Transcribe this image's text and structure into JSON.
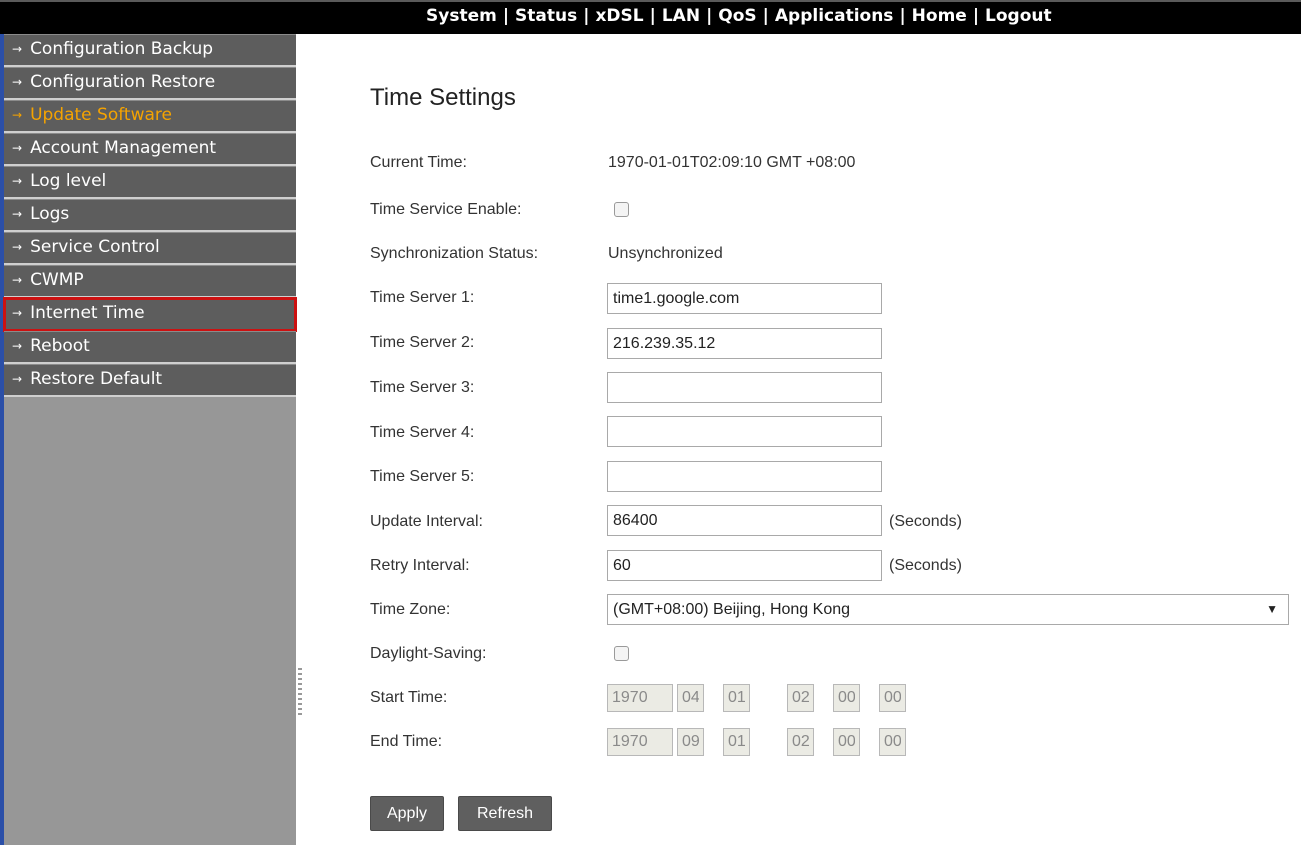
{
  "topnav": {
    "items": [
      "System",
      "Status",
      "xDSL",
      "LAN",
      "QoS",
      "Applications",
      "Home",
      "Logout"
    ],
    "separator": "|"
  },
  "sidebar": {
    "arrow_icon": "→",
    "items": [
      {
        "label": "Configuration Backup"
      },
      {
        "label": "Configuration Restore"
      },
      {
        "label": "Update Software",
        "active": true
      },
      {
        "label": "Account Management"
      },
      {
        "label": "Log level"
      },
      {
        "label": "Logs"
      },
      {
        "label": "Service Control"
      },
      {
        "label": "CWMP"
      },
      {
        "label": "Internet Time",
        "highlighted": true
      },
      {
        "label": "Reboot"
      },
      {
        "label": "Restore Default"
      }
    ]
  },
  "page": {
    "title": "Time Settings",
    "current_time": {
      "label": "Current Time:",
      "value": "1970-01-01T02:09:10 GMT +08:00"
    },
    "time_service": {
      "label": "Time Service Enable:",
      "checked": false
    },
    "sync_status": {
      "label": "Synchronization Status:",
      "value": "Unsynchronized"
    },
    "servers": [
      {
        "label": "Time Server 1:",
        "value": "time1.google.com"
      },
      {
        "label": "Time Server 2:",
        "value": "216.239.35.12"
      },
      {
        "label": "Time Server 3:",
        "value": ""
      },
      {
        "label": "Time Server 4:",
        "value": ""
      },
      {
        "label": "Time Server 5:",
        "value": ""
      }
    ],
    "update_interval": {
      "label": "Update Interval:",
      "value": "86400",
      "unit": "(Seconds)"
    },
    "retry_interval": {
      "label": "Retry Interval:",
      "value": "60",
      "unit": "(Seconds)"
    },
    "time_zone": {
      "label": "Time Zone:",
      "value": "(GMT+08:00) Beijing, Hong Kong",
      "caret": "▼"
    },
    "daylight_saving": {
      "label": "Daylight-Saving:",
      "checked": false
    },
    "start_time": {
      "label": "Start Time:",
      "year": "1970",
      "month": "04",
      "day": "01",
      "hour": "02",
      "minute": "00",
      "second": "00"
    },
    "end_time": {
      "label": "End Time:",
      "year": "1970",
      "month": "09",
      "day": "01",
      "hour": "02",
      "minute": "00",
      "second": "00"
    },
    "buttons": {
      "apply": "Apply",
      "refresh": "Refresh"
    }
  },
  "colors": {
    "topbar_bg": "#000000",
    "sidebar_bg": "#979797",
    "menu_item_bg": "#5d5d5d",
    "active_item_text": "#f5a300",
    "highlight_border": "#cc1111",
    "button_bg": "#5f5f5f"
  }
}
